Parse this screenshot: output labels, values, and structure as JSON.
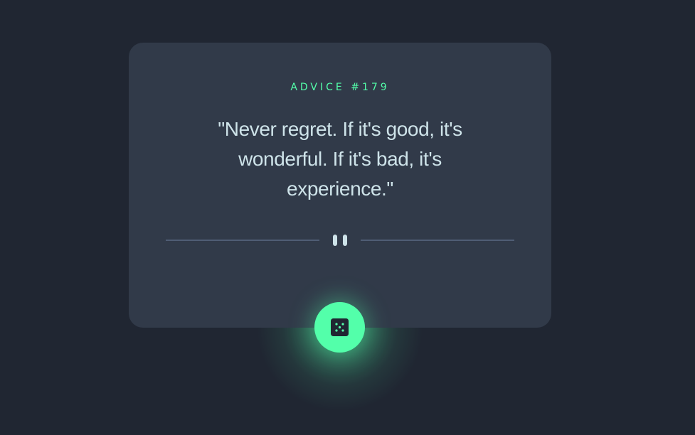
{
  "advice": {
    "label": "ADVICE #",
    "number": "179",
    "quote": "\"Never regret. If it's good, it's wonderful. If it's bad, it's experience.\""
  },
  "icons": {
    "divider": "pause-icon",
    "button": "dice-icon"
  },
  "colors": {
    "background": "#202632",
    "card": "#313a49",
    "accent": "#53ffaa",
    "text": "#cee3e9",
    "divider": "#4f5d74"
  }
}
